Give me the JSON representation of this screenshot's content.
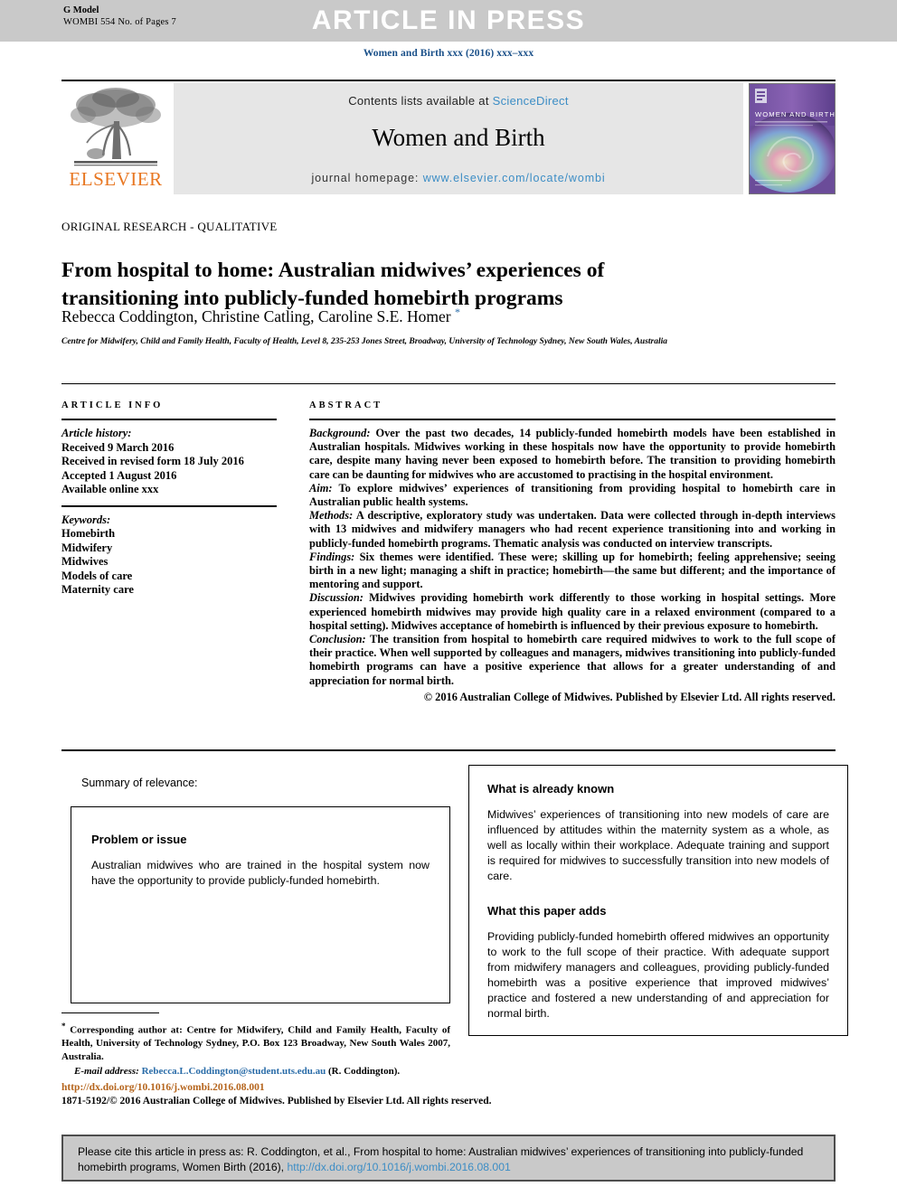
{
  "banner": {
    "g_model": "G Model",
    "doc_id": "WOMBI 554 No. of Pages 7",
    "status": "ARTICLE IN PRESS"
  },
  "journal_ref": "Women and Birth xxx (2016) xxx–xxx",
  "journal_banner": {
    "contents_prefix": "Contents lists available at ",
    "sciencedirect": "ScienceDirect",
    "journal_name": "Women and Birth",
    "homepage_prefix": "journal homepage: ",
    "homepage_url": "www.elsevier.com/locate/wombi",
    "publisher": "ELSEVIER",
    "cover_title": "WOMEN AND BIRTH"
  },
  "article": {
    "kicker": "ORIGINAL RESEARCH - QUALITATIVE",
    "title": "From hospital to home: Australian midwives’ experiences of transitioning into publicly-funded homebirth programs",
    "authors": "Rebecca Coddington, Christine Catling, Caroline S.E. Homer",
    "affiliation": "Centre for Midwifery, Child and Family Health, Faculty of Health, Level 8, 235-253 Jones Street, Broadway, University of Technology Sydney, New South Wales, Australia"
  },
  "info": {
    "heading": "ARTICLE INFO",
    "history_label": "Article history:",
    "history": [
      "Received 9 March 2016",
      "Received in revised form 18 July 2016",
      "Accepted 1 August 2016",
      "Available online xxx"
    ],
    "keywords_label": "Keywords:",
    "keywords": [
      "Homebirth",
      "Midwifery",
      "Midwives",
      "Models of care",
      "Maternity care"
    ]
  },
  "abstract": {
    "heading": "ABSTRACT",
    "sections": [
      {
        "lead": "Background:",
        "text": " Over the past two decades, 14 publicly-funded homebirth models have been established in Australian hospitals. Midwives working in these hospitals now have the opportunity to provide homebirth care, despite many having never been exposed to homebirth before. The transition to providing homebirth care can be daunting for midwives who are accustomed to practising in the hospital environment."
      },
      {
        "lead": "Aim:",
        "text": " To explore midwives’ experiences of transitioning from providing hospital to homebirth care in Australian public health systems."
      },
      {
        "lead": "Methods:",
        "text": " A descriptive, exploratory study was undertaken. Data were collected through in-depth interviews with 13 midwives and midwifery managers who had recent experience transitioning into and working in publicly-funded homebirth programs. Thematic analysis was conducted on interview transcripts."
      },
      {
        "lead": "Findings:",
        "text": " Six themes were identified. These were; skilling up for homebirth; feeling apprehensive; seeing birth in a new light; managing a shift in practice; homebirth—the same but different; and the importance of mentoring and support."
      },
      {
        "lead": "Discussion:",
        "text": " Midwives providing homebirth work differently to those working in hospital settings. More experienced homebirth midwives may provide high quality care in a relaxed environment (compared to a hospital setting). Midwives acceptance of homebirth is influenced by their previous exposure to homebirth."
      },
      {
        "lead": "Conclusion:",
        "text": " The transition from hospital to homebirth care required midwives to work to the full scope of their practice. When well supported by colleagues and managers, midwives transitioning into publicly-funded homebirth programs can have a positive experience that allows for a greater understanding of and appreciation for normal birth."
      }
    ],
    "copyright": "© 2016 Australian College of Midwives. Published by Elsevier Ltd. All rights reserved."
  },
  "summary": {
    "label": "Summary of relevance:",
    "left_box": {
      "heading": "Problem or issue",
      "text": "Australian midwives who are trained in the hospital system now have the opportunity to provide publicly-funded homebirth."
    },
    "right_box": {
      "heading_known": "What is already known",
      "text_known": "Midwives’ experiences of transitioning into new models of care are influenced by attitudes within the maternity system as a whole, as well as locally within their workplace. Adequate training and support is required for midwives to successfully transition into new models of care.",
      "heading_adds": "What this paper adds",
      "text_adds": "Providing publicly-funded homebirth offered midwives an opportunity to work to the full scope of their practice. With adequate support from midwifery managers and colleagues, providing publicly-funded homebirth was a positive experience that improved midwives’ practice and fostered a new understanding of and appreciation for normal birth."
    }
  },
  "footnotes": {
    "corresponding": "Corresponding author at: Centre for Midwifery, Child and Family Health, Faculty of Health, University of Technology Sydney, P.O. Box 123 Broadway, New South Wales 2007, Australia.",
    "email_label": "E-mail address:",
    "email": "Rebecca.L.Coddington@student.uts.edu.au",
    "email_suffix": " (R. Coddington).",
    "doi": "http://dx.doi.org/10.1016/j.wombi.2016.08.001",
    "issn_line": "1871-5192/© 2016 Australian College of Midwives. Published by Elsevier Ltd. All rights reserved."
  },
  "citation": {
    "text_before": "Please cite this article in press as: R. Coddington, et al., From hospital to home: Australian midwives’ experiences of transitioning into publicly-funded homebirth programs, Women Birth (2016), ",
    "link": "http://dx.doi.org/10.1016/j.wombi.2016.08.001"
  },
  "colors": {
    "banner_grey": "#c9c9c9",
    "journal_blue": "#1a5089",
    "link_blue": "#3c8dc5",
    "elsevier_orange": "#e87722",
    "doi_orange": "#b5651d"
  }
}
